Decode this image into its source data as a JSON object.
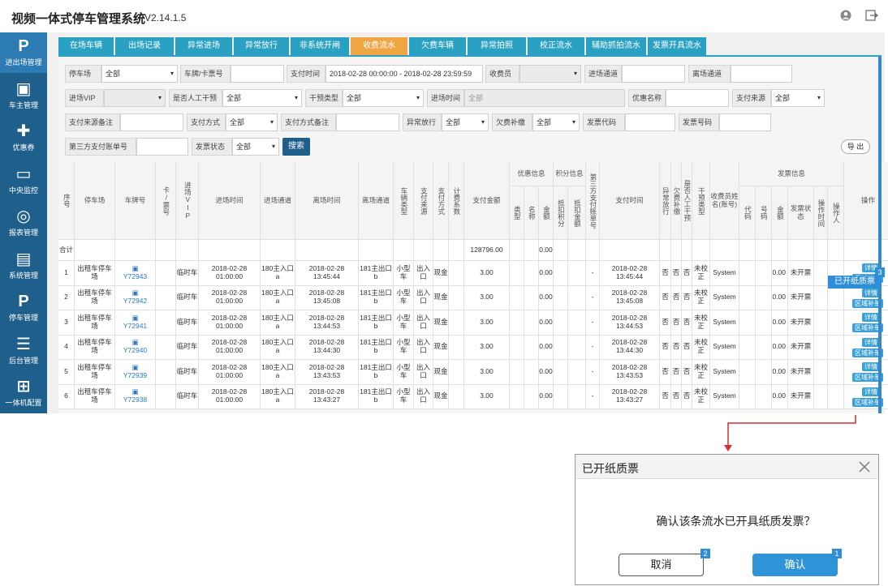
{
  "app": {
    "title": "视频一体式停车管理系统",
    "version": "V2.14.1.5"
  },
  "sidebar": {
    "items": [
      {
        "label": "进出场管理",
        "icon": "parking-p-icon",
        "glyph": "P"
      },
      {
        "label": "车主管理",
        "icon": "vip-card-icon",
        "glyph": ""
      },
      {
        "label": "优惠券",
        "icon": "ticket-icon",
        "glyph": ""
      },
      {
        "label": "中央监控",
        "icon": "monitor-icon",
        "glyph": ""
      },
      {
        "label": "报表管理",
        "icon": "report-icon",
        "glyph": ""
      },
      {
        "label": "系统管理",
        "icon": "system-monitor-icon",
        "glyph": ""
      },
      {
        "label": "停车管理",
        "icon": "parking-p-icon",
        "glyph": "P"
      },
      {
        "label": "后台管理",
        "icon": "list-icon",
        "glyph": ""
      },
      {
        "label": "一体机配置",
        "icon": "device-tree-icon",
        "glyph": ""
      }
    ]
  },
  "tabs": [
    "在场车辆",
    "出场记录",
    "异常进场",
    "异常放行",
    "非系统开闸",
    "收费流水",
    "欠费车辆",
    "异常拍照",
    "校正流水",
    "辅助抓拍流水",
    "发票开具流水"
  ],
  "filters": {
    "row1": {
      "parking_label": "停车场",
      "parking_value": "全部",
      "plate_label": "车牌/卡票号",
      "plate_value": "",
      "paytime_label": "支付时间",
      "paytime_value": "2018-02-28 00:00:00 - 2018-02-28 23:59:59",
      "collector_label": "收费员",
      "collector_value": "",
      "in_lane_label": "进场通道",
      "in_lane_value": "",
      "out_lane_label": "离场通道",
      "out_lane_value": ""
    },
    "row2": {
      "vip_label": "进场VIP",
      "vip_value": "",
      "manual_label": "是否人工干预",
      "manual_value": "全部",
      "intervene_label": "干预类型",
      "intervene_value": "全部",
      "intime_label": "进场时间",
      "intime_value": "全部",
      "discount_label": "优惠名称",
      "discount_value": "",
      "source_label": "支付来源",
      "source_value": "全部"
    },
    "row3": {
      "source_note_label": "支付来源备注",
      "source_note_value": "",
      "method_label": "支付方式",
      "method_value": "全部",
      "method_note_label": "支付方式备注",
      "method_note_value": "",
      "abnormal_label": "异常放行",
      "abnormal_value": "全部",
      "arrears_label": "欠费补缴",
      "arrears_value": "全部",
      "invoice_code_label": "发票代码",
      "invoice_code_value": "",
      "invoice_no_label": "发票号码",
      "invoice_no_value": ""
    },
    "row4": {
      "third_label": "第三方支付账单号",
      "third_value": "",
      "invoice_state_label": "发票状态",
      "invoice_state_value": "全部",
      "search_label": "搜索",
      "export_label": "导 出"
    }
  },
  "table": {
    "group_headers": {
      "discount": "优惠信息",
      "points": "积分信息",
      "invoice": "发票信息"
    },
    "headers": {
      "seq": "序号",
      "lot": "停车场",
      "plate": "车牌号",
      "card": "卡/票号",
      "vip": "进场VIP",
      "in_time": "进场时间",
      "in_lane": "进场通道",
      "out_time": "离场时间",
      "out_lane": "离场通道",
      "car_type": "车辆类型",
      "pay_source": "支付来源",
      "pay_method": "支付方式",
      "coef": "计费系数",
      "amount": "支付金额",
      "d_type": "类型",
      "d_name": "名称",
      "d_amount": "金额",
      "p_deduct": "抵扣积分",
      "p_amount": "抵扣金额",
      "third_bill": "第三方支付账单号",
      "pay_time": "支付时间",
      "abnormal": "异常放行",
      "arrears": "欠费补缴",
      "manual": "是否人工干预",
      "intervene": "干预类型",
      "collector": "收费员姓名(账号)",
      "i_code": "代码",
      "i_no": "号码",
      "i_amount": "金额",
      "i_state": "发票状态",
      "i_optime": "操作时间",
      "i_operator": "操作人",
      "ops": "操作"
    },
    "total": {
      "label": "合计",
      "amount": "128796.00",
      "d_amount": "0.00"
    },
    "rows": [
      {
        "seq": "1",
        "lot": "出租车停车场",
        "plate": "Y72943",
        "vip": "临时车",
        "in_time": "2018-02-28 01:00:00",
        "in_lane": "180主入口a",
        "out_time": "2018-02-28 13:45:44",
        "out_lane": "181主出口b",
        "car_type": "小型车",
        "pay_source": "出入口",
        "pay_method": "现金",
        "amount": "3.00",
        "d_amount": "0.00",
        "third": "-",
        "pay_time": "2018-02-28 13:45:44",
        "abnormal": "否",
        "arrears": "否",
        "manual": "否",
        "intervene": "未校正",
        "collector": "System",
        "i_amount": "0.00",
        "i_state": "未开票"
      },
      {
        "seq": "2",
        "lot": "出租车停车场",
        "plate": "Y72942",
        "vip": "临时车",
        "in_time": "2018-02-28 01:00:00",
        "in_lane": "180主入口a",
        "out_time": "2018-02-28 13:45:08",
        "out_lane": "181主出口b",
        "car_type": "小型车",
        "pay_source": "出入口",
        "pay_method": "现金",
        "amount": "3.00",
        "d_amount": "0.00",
        "third": "-",
        "pay_time": "2018-02-28 13:45:08",
        "abnormal": "否",
        "arrears": "否",
        "manual": "否",
        "intervene": "未校正",
        "collector": "System",
        "i_amount": "0.00",
        "i_state": "未开票"
      },
      {
        "seq": "3",
        "lot": "出租车停车场",
        "plate": "Y72941",
        "vip": "临时车",
        "in_time": "2018-02-28 01:00:00",
        "in_lane": "180主入口a",
        "out_time": "2018-02-28 13:44:53",
        "out_lane": "181主出口b",
        "car_type": "小型车",
        "pay_source": "出入口",
        "pay_method": "现金",
        "amount": "3.00",
        "d_amount": "0.00",
        "third": "-",
        "pay_time": "2018-02-28 13:44:53",
        "abnormal": "否",
        "arrears": "否",
        "manual": "否",
        "intervene": "未校正",
        "collector": "System",
        "i_amount": "0.00",
        "i_state": "未开票"
      },
      {
        "seq": "4",
        "lot": "出租车停车场",
        "plate": "Y72940",
        "vip": "临时车",
        "in_time": "2018-02-28 01:00:00",
        "in_lane": "180主入口a",
        "out_time": "2018-02-28 13:44:30",
        "out_lane": "181主出口b",
        "car_type": "小型车",
        "pay_source": "出入口",
        "pay_method": "现金",
        "amount": "3.00",
        "d_amount": "0.00",
        "third": "-",
        "pay_time": "2018-02-28 13:44:30",
        "abnormal": "否",
        "arrears": "否",
        "manual": "否",
        "intervene": "未校正",
        "collector": "System",
        "i_amount": "0.00",
        "i_state": "未开票"
      },
      {
        "seq": "5",
        "lot": "出租车停车场",
        "plate": "Y72939",
        "vip": "临时车",
        "in_time": "2018-02-28 01:00:00",
        "in_lane": "180主入口a",
        "out_time": "2018-02-28 13:43:53",
        "out_lane": "181主出口b",
        "car_type": "小型车",
        "pay_source": "出入口",
        "pay_method": "现金",
        "amount": "3.00",
        "d_amount": "0.00",
        "third": "-",
        "pay_time": "2018-02-28 13:43:53",
        "abnormal": "否",
        "arrears": "否",
        "manual": "否",
        "intervene": "未校正",
        "collector": "System",
        "i_amount": "0.00",
        "i_state": "未开票"
      },
      {
        "seq": "6",
        "lot": "出租车停车场",
        "plate": "Y72938",
        "vip": "临时车",
        "in_time": "2018-02-28 01:00:00",
        "in_lane": "180主入口a",
        "out_time": "2018-02-28 13:43:27",
        "out_lane": "181主出口b",
        "car_type": "小型车",
        "pay_source": "出入口",
        "pay_method": "现金",
        "amount": "3.00",
        "d_amount": "0.00",
        "third": "-",
        "pay_time": "2018-02-28 13:43:27",
        "abnormal": "否",
        "arrears": "否",
        "manual": "否",
        "intervene": "未校正",
        "collector": "System",
        "i_amount": "0.00",
        "i_state": "未开票"
      }
    ],
    "row_actions": {
      "detail": "详情",
      "refund": "区域补单"
    },
    "callout": {
      "label": "已开纸质票",
      "badge": "3"
    }
  },
  "dialog": {
    "title": "已开纸质票",
    "message": "确认该条流水已开具纸质发票？",
    "cancel_label": "取消",
    "ok_label": "确认",
    "cancel_badge": "2",
    "ok_badge": "1"
  },
  "colors": {
    "sidebar": "#1f5f8b",
    "tab": "#2aa0c2",
    "tab_active": "#f0a545",
    "accent": "#2e8fd8",
    "connector": "#d32f2f"
  }
}
